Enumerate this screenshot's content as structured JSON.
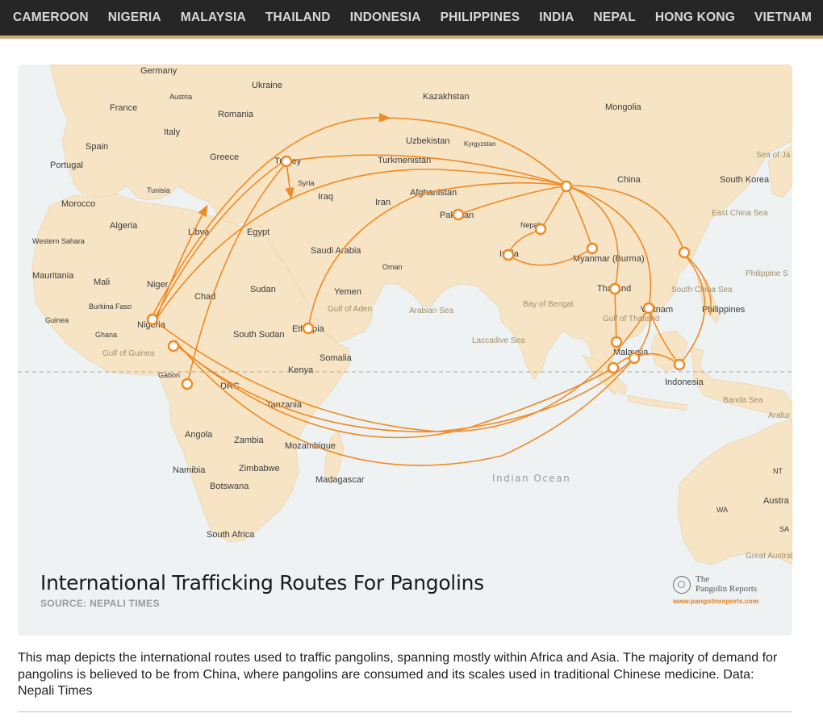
{
  "nav": {
    "items": [
      "CAMEROON",
      "NIGERIA",
      "MALAYSIA",
      "THAILAND",
      "INDONESIA",
      "PHILIPPINES",
      "INDIA",
      "NEPAL",
      "HONG KONG",
      "VIETNAM"
    ]
  },
  "map": {
    "title": "International Trafficking Routes For Pangolins",
    "source": "SOURCE: NEPALI TIMES",
    "route_color": "#f08a24",
    "land_color": "#f6e4c4",
    "water_color": "#eef2f3",
    "labels": {
      "germany": "Germany",
      "ukraine": "Ukraine",
      "kazakhstan": "Kazakhstan",
      "mongolia": "Mongolia",
      "austria": "Austria",
      "france": "France",
      "romania": "Romania",
      "italy": "Italy",
      "spain": "Spain",
      "portugal": "Portugal",
      "greece": "Greece",
      "turkey": "Turkey",
      "uzbekistan": "Uzbekistan",
      "kyrgyzstan": "Kyrgyzstan",
      "turkmenistan": "Turkmenistan",
      "sea_of_japan": "Sea of Ja",
      "china": "China",
      "south_korea": "South Korea",
      "tunisia": "Tunisia",
      "syria": "Syria",
      "iraq": "Iraq",
      "iran": "Iran",
      "afghanistan": "Afghanistan",
      "morocco": "Morocco",
      "algeria": "Algeria",
      "libya": "Libya",
      "egypt": "Egypt",
      "pakistan": "Pakistan",
      "nepal": "Nepal",
      "east_china_sea": "East China Sea",
      "western_sahara": "Western Sahara",
      "saudi_arabia": "Saudi Arabia",
      "oman": "Oman",
      "india": "India",
      "myanmar": "Myanmar (Burma)",
      "philippine_sea": "Philippine S",
      "mauritania": "Mauritania",
      "mali": "Mali",
      "niger": "Niger",
      "sudan": "Sudan",
      "yemen": "Yemen",
      "thailand": "Thailand",
      "chad": "Chad",
      "south_china_sea": "South China Sea",
      "burkina_faso": "Burkina Faso",
      "gulf_of_aden": "Gulf of Aden",
      "arabian_sea": "Arabian Sea",
      "bay_of_bengal": "Bay of Bengal",
      "vietnam": "Vietnam",
      "philippines": "Philippines",
      "guinea": "Guinea",
      "nigeria": "Nigeria",
      "ghana": "Ghana",
      "south_sudan": "South Sudan",
      "ethiopia": "Ethiopia",
      "gulf_of_thailand": "Gulf of Thailand",
      "laccadive_sea": "Laccadive Sea",
      "gulf_of_guinea": "Gulf of Guinea",
      "somalia": "Somalia",
      "malaysia": "Malaysia",
      "gabon": "Gabon",
      "kenya": "Kenya",
      "drc": "DRC",
      "indonesia": "Indonesia",
      "tanzania": "Tanzania",
      "banda_sea": "Banda Sea",
      "arafura": "Arafur",
      "angola": "Angola",
      "zambia": "Zambia",
      "mozambique": "Mozambique",
      "namibia": "Namibia",
      "zimbabwe": "Zimbabwe",
      "nt": "NT",
      "madagascar": "Madagascar",
      "botswana": "Botswana",
      "indian_ocean": "Indian Ocean",
      "australia": "Austra",
      "wa": "WA",
      "sa": "SA",
      "south_africa": "South Africa",
      "great_australian_bight": "Great Australian Bight"
    },
    "logo": {
      "line1": "The",
      "line2": "Pangolin Reports",
      "url": "www.pangolinreports.com"
    }
  },
  "caption": "This map depicts the international routes used to traffic pangolins, spanning mostly within Africa and Asia. The majority of demand for pangolins is believed to be from China, where pangolins are consumed and its scales used in traditional Chinese medicine. Data: Nepali Times"
}
